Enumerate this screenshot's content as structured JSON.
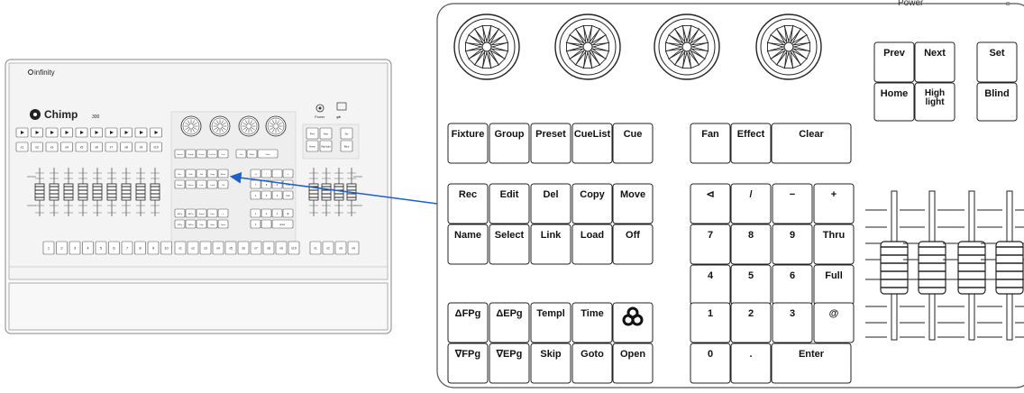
{
  "brand": "infinity",
  "model": "Chimp",
  "model_number": "300",
  "power_label": "Power",
  "top_right_partial": "Power",
  "accent_color": "#3a6fd0",
  "nav_keys": [
    "Prev",
    "Next",
    "Set",
    "Home",
    "High light",
    "Blind"
  ],
  "function_keys_row1": [
    "Fixture",
    "Group",
    "Preset",
    "CueList",
    "Cue"
  ],
  "function_keys_row2": [
    "Rec",
    "Edit",
    "Del",
    "Copy",
    "Move"
  ],
  "function_keys_row3": [
    "Name",
    "Select",
    "Link",
    "Load",
    "Off"
  ],
  "function_keys_row4": [
    "ΔFPg",
    "ΔEPg",
    "Templ",
    "Time",
    "logo"
  ],
  "function_keys_row5": [
    "∇FPg",
    "∇EPg",
    "Skip",
    "Goto",
    "Open"
  ],
  "top_keys": [
    "Fan",
    "Effect",
    "Clear"
  ],
  "numpad_row1": [
    "⊲",
    "/",
    "−",
    "+"
  ],
  "numpad_row2": [
    "7",
    "8",
    "9",
    "Thru"
  ],
  "numpad_row3": [
    "4",
    "5",
    "6",
    "Full"
  ],
  "numpad_row4": [
    "1",
    "2",
    "3",
    "@"
  ],
  "numpad_row5": [
    "0",
    ".",
    "Enter"
  ],
  "overview_playback_labels": [
    "x1",
    "x2",
    "x3",
    "x4",
    "x5",
    "x6",
    "x7",
    "x8",
    "x9",
    "x10"
  ],
  "overview_bottom_labels": [
    "1",
    "2",
    "3",
    "4",
    "5",
    "6",
    "7",
    "8",
    "9",
    "10"
  ],
  "overview_bottom_right_labels": [
    "x1",
    "x2",
    "x3",
    "x4",
    "x5",
    "x6",
    "x7",
    "x8",
    "x9",
    "x10"
  ],
  "overview_extra_labels": [
    "x1",
    "x2",
    "x3",
    "x4"
  ]
}
